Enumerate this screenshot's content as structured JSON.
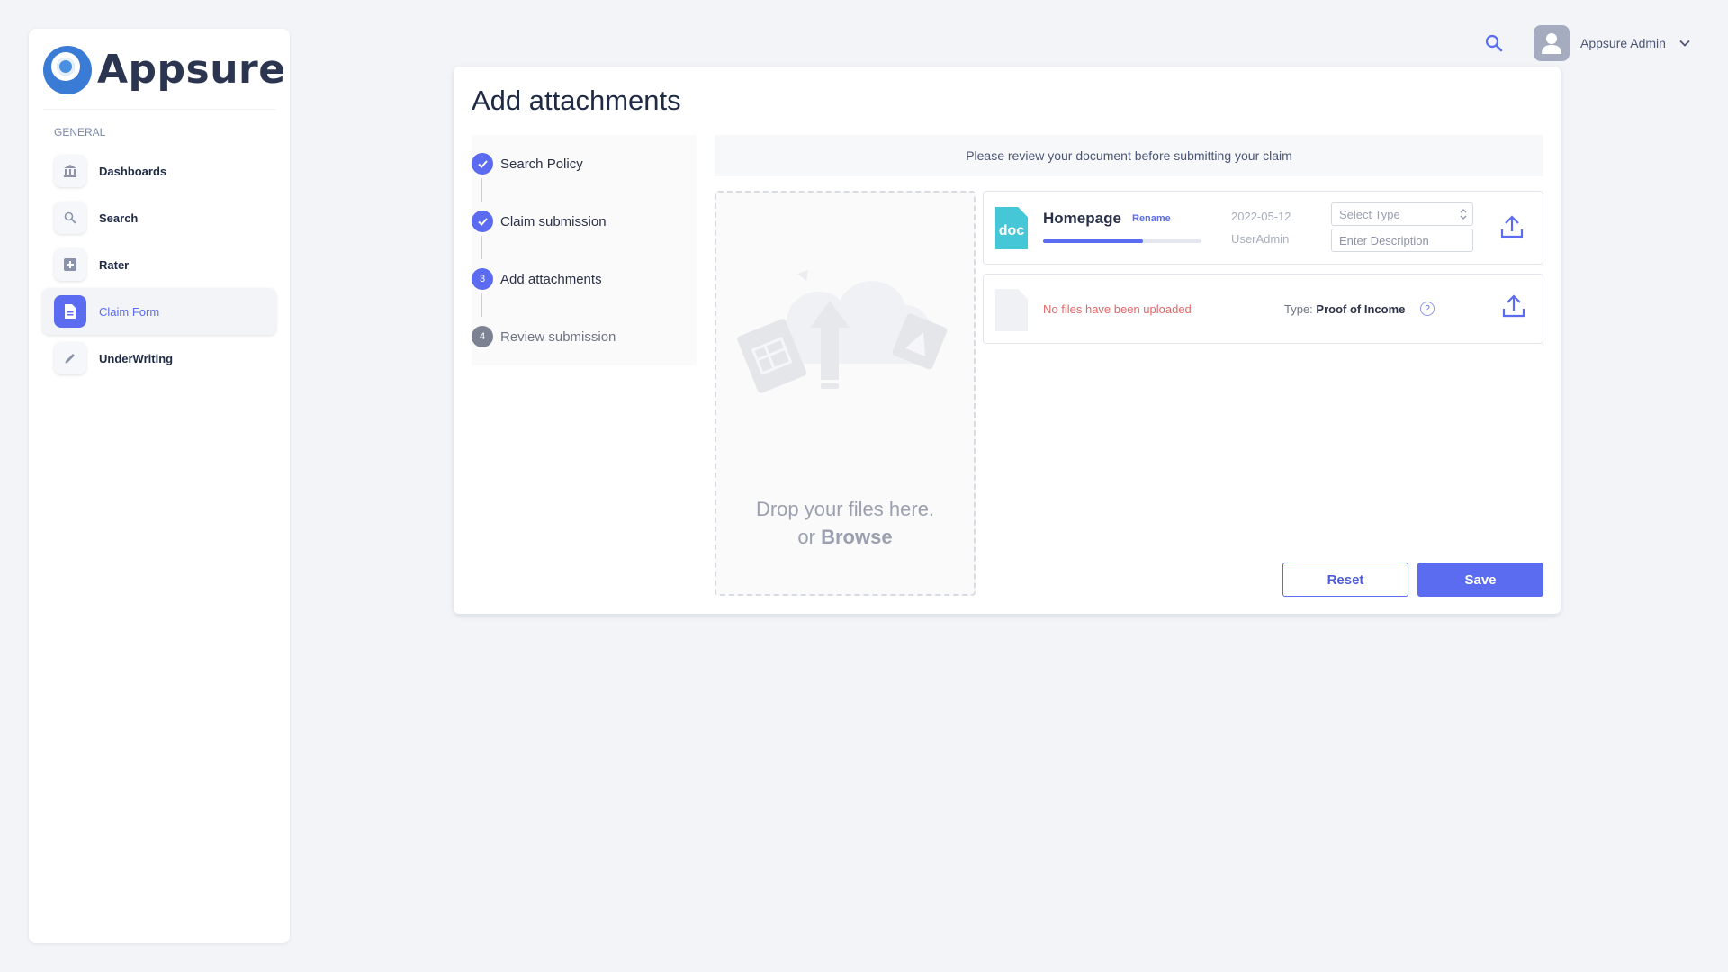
{
  "brand": {
    "name": "Appsure"
  },
  "sidebar": {
    "section_label": "GENERAL",
    "items": [
      {
        "label": "Dashboards",
        "icon": "bank-icon",
        "active": false
      },
      {
        "label": "Search",
        "icon": "search-icon",
        "active": false
      },
      {
        "label": "Rater",
        "icon": "plus-square-icon",
        "active": false
      },
      {
        "label": "Claim Form",
        "icon": "document-icon",
        "active": true
      },
      {
        "label": "UnderWriting",
        "icon": "pencil-icon",
        "active": false
      }
    ]
  },
  "header": {
    "user_name": "Appsure Admin"
  },
  "page": {
    "title": "Add attachments",
    "notice": "Please review your document before submitting your claim"
  },
  "stepper": {
    "steps": [
      {
        "label": "Search Policy",
        "status": "done",
        "number": "1"
      },
      {
        "label": "Claim submission",
        "status": "done",
        "number": "2"
      },
      {
        "label": "Add attachments",
        "status": "current",
        "number": "3"
      },
      {
        "label": "Review submission",
        "status": "pending",
        "number": "4"
      }
    ]
  },
  "dropzone": {
    "line1": "Drop your files here.",
    "line2_prefix": "or",
    "browse": "Browse"
  },
  "files": [
    {
      "icon_label": "doc",
      "name": "Homepage",
      "rename_label": "Rename",
      "progress": 0.63,
      "date": "2022-05-12",
      "user": "UserAdmin",
      "select_placeholder": "Select Type",
      "description_placeholder": "Enter Description"
    }
  ],
  "required": {
    "empty_message": "No files have been uploaded",
    "type_label": "Type:",
    "type_value": "Proof of Income",
    "help_glyph": "?"
  },
  "actions": {
    "reset_label": "Reset",
    "save_label": "Save"
  },
  "colors": {
    "accent": "#5b6cf0",
    "doc_icon": "#46c7d8",
    "error_text": "#e06868"
  }
}
